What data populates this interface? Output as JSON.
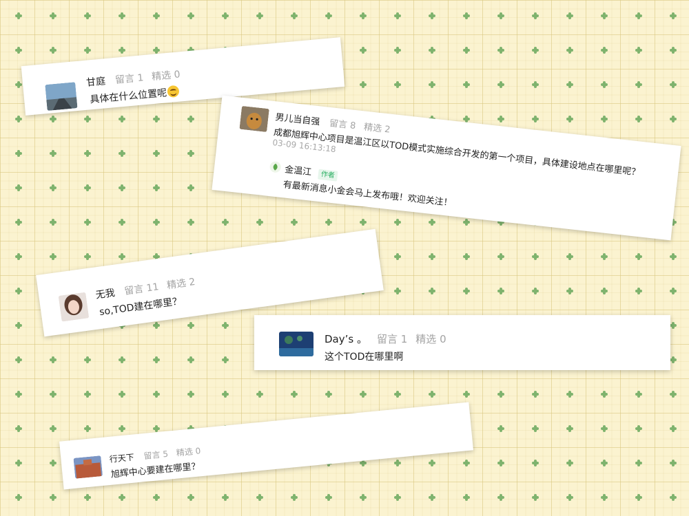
{
  "comments": [
    {
      "name": "甘庭",
      "liuyan": "留言 1",
      "jingxuan": "精选 0",
      "text": "具体在什么位置呢",
      "avatar": "road-photo-avatar"
    },
    {
      "name": "男儿当自强",
      "liuyan": "留言 8",
      "jingxuan": "精选 2",
      "text": "成都旭辉中心项目是温江区以TOD模式实施综合开发的第一个项目，具体建设地点在哪里呢？",
      "time": "03-09 16:13:18",
      "avatar": "dog-photo-avatar",
      "reply": {
        "name": "金温江",
        "tag": "作者",
        "text": "有最新消息小金会马上发布哦！欢迎关注！",
        "avatar": "leaf-logo-avatar"
      }
    },
    {
      "name": "无我",
      "liuyan": "留言 11",
      "jingxuan": "精选 2",
      "text": "so,TOD建在哪里？",
      "avatar": "girl-photo-avatar"
    },
    {
      "name": "Day’s 。",
      "liuyan": "留言 1",
      "jingxuan": "精选 0",
      "text": "这个TOD在哪里啊",
      "avatar": "night-scene-avatar"
    },
    {
      "name": "行天下",
      "liuyan": "留言 5",
      "jingxuan": "精选 0",
      "text": "旭辉中心要建在哪里？",
      "avatar": "building-photo-avatar"
    }
  ],
  "colors": {
    "background": "#fbf3d0",
    "author_tag": "#27ae60",
    "stat_gray": "#a3a3a3"
  }
}
